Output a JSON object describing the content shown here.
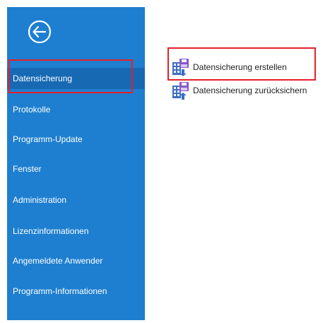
{
  "sidebar": {
    "back_icon": "arrow-left-circle-icon",
    "items": [
      {
        "label": "Datensicherung",
        "active": true
      },
      {
        "label": "Protokolle"
      },
      {
        "label": "Programm-Update"
      },
      {
        "label": "Fenster"
      },
      {
        "label": "Administration"
      },
      {
        "label": "Lizenzinformationen"
      },
      {
        "label": "Angemeldete Anwender"
      },
      {
        "label": "Programm-Informationen"
      }
    ]
  },
  "content": {
    "actions": [
      {
        "label": "Datensicherung erstellen",
        "icon": "database-backup-icon"
      },
      {
        "label": "Datensicherung zurücksichern",
        "icon": "database-restore-icon"
      }
    ]
  },
  "colors": {
    "sidebar_bg": "#1e7fd0",
    "sidebar_active": "#1769b4",
    "highlight": "#e5202a",
    "icon_blue": "#3b6fc4",
    "icon_purple": "#8a56c8"
  }
}
